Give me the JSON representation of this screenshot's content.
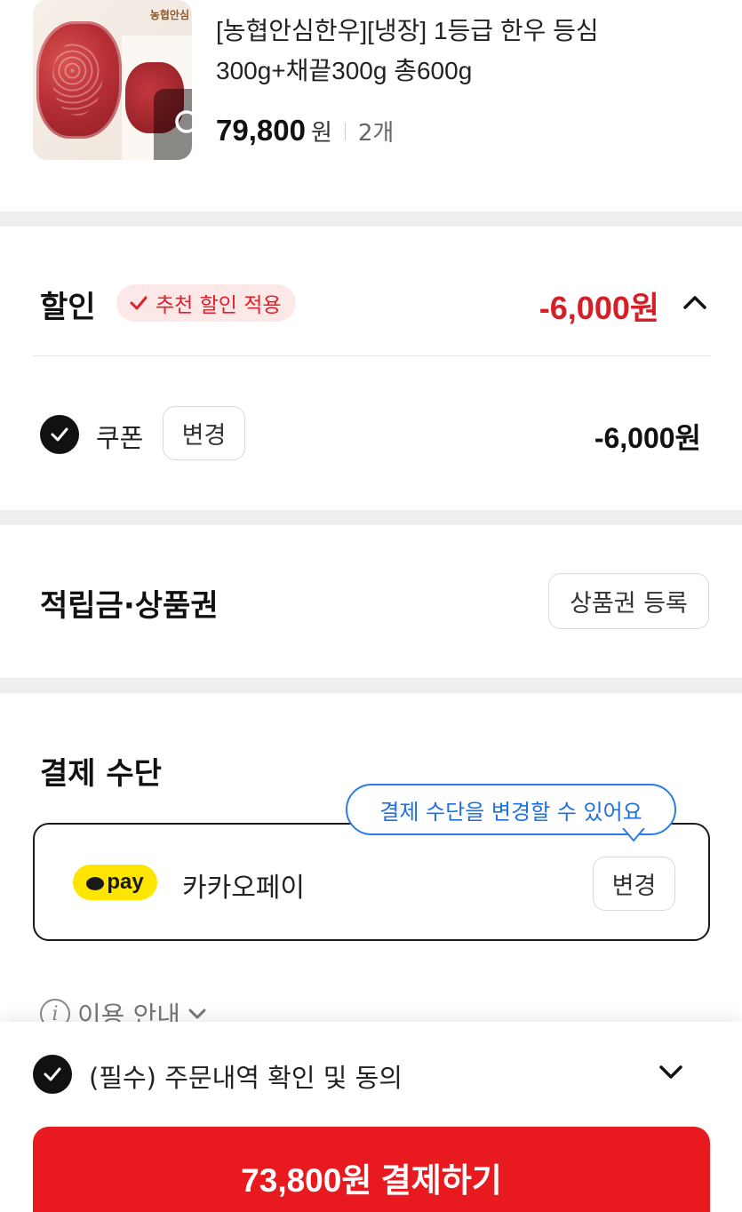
{
  "product": {
    "brand_logo_text": "농협안심",
    "title_line1": "[농협안심한우][냉장] 1등급 한우 등심",
    "title_line2": "300g+채끝300g 총600g",
    "price": "79,800",
    "currency": "원",
    "quantity": "2개"
  },
  "discount": {
    "title": "할인",
    "badge_label": "추천 할인 적용",
    "total": "-6,000원",
    "coupon_label": "쿠폰",
    "coupon_change_label": "변경",
    "coupon_amount": "-6,000원"
  },
  "points": {
    "title": "적립금·상품권",
    "register_label": "상품권 등록"
  },
  "payment": {
    "title": "결제 수단",
    "tooltip": "결제 수단을 변경할 수 있어요",
    "kakaopay_logo": "pay",
    "method_name": "카카오페이",
    "change_label": "변경"
  },
  "info": {
    "label": "이용 안내"
  },
  "footer": {
    "agree_label": "(필수) 주문내역 확인 및 동의",
    "pay_button_label": "73,800원 결제하기"
  },
  "colors": {
    "accent_red": "#e8191f",
    "discount_red": "#d51f27",
    "tooltip_blue": "#2b7be6",
    "kakao_yellow": "#fee500"
  }
}
